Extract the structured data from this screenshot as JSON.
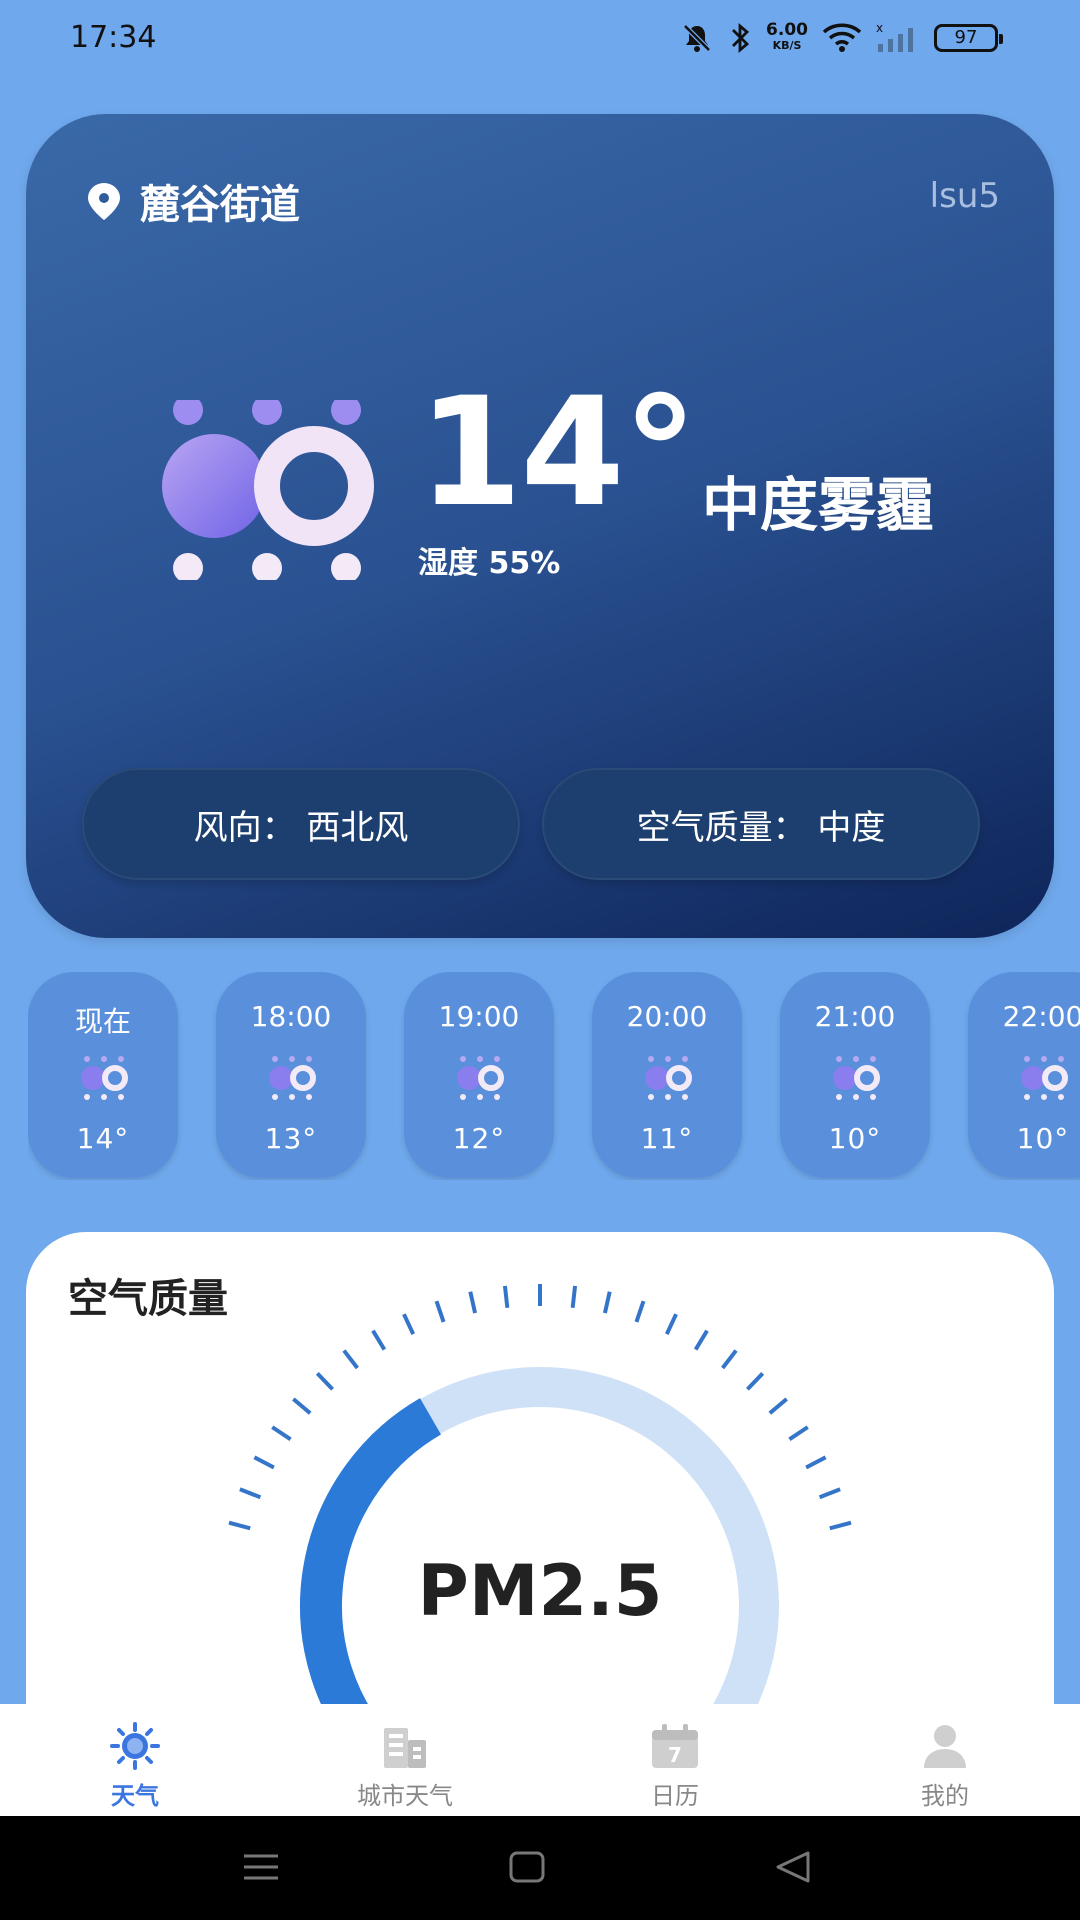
{
  "status": {
    "time": "17:34",
    "net_speed": "6.00",
    "net_unit": "KB/S",
    "battery": "97"
  },
  "card": {
    "location": "麓谷街道",
    "corner_tag": "lsu5",
    "temperature": "14°",
    "condition": "中度雾霾",
    "humidity": "湿度 55%",
    "wind": "风向：  西北风",
    "air_quality": "空气质量：  中度"
  },
  "hourly": [
    {
      "time": "现在",
      "temp": "14°"
    },
    {
      "time": "18:00",
      "temp": "13°"
    },
    {
      "time": "19:00",
      "temp": "12°"
    },
    {
      "time": "20:00",
      "temp": "11°"
    },
    {
      "time": "21:00",
      "temp": "10°"
    },
    {
      "time": "22:00",
      "temp": "10°"
    }
  ],
  "air": {
    "title": "空气质量",
    "pm_label": "PM2.5"
  },
  "tabs": [
    {
      "label": "天气",
      "icon": "sun-icon",
      "active": true
    },
    {
      "label": "城市天气",
      "icon": "building-icon",
      "active": false
    },
    {
      "label": "日历",
      "icon": "calendar-icon",
      "active": false
    },
    {
      "label": "我的",
      "icon": "user-icon",
      "active": false
    }
  ],
  "colors": {
    "background": "#6fa8ec",
    "accent": "#3b76e0",
    "card_dark": "#0e2559",
    "gauge_fill": "#2b7ad8",
    "gauge_track": "#cfe1f7"
  }
}
